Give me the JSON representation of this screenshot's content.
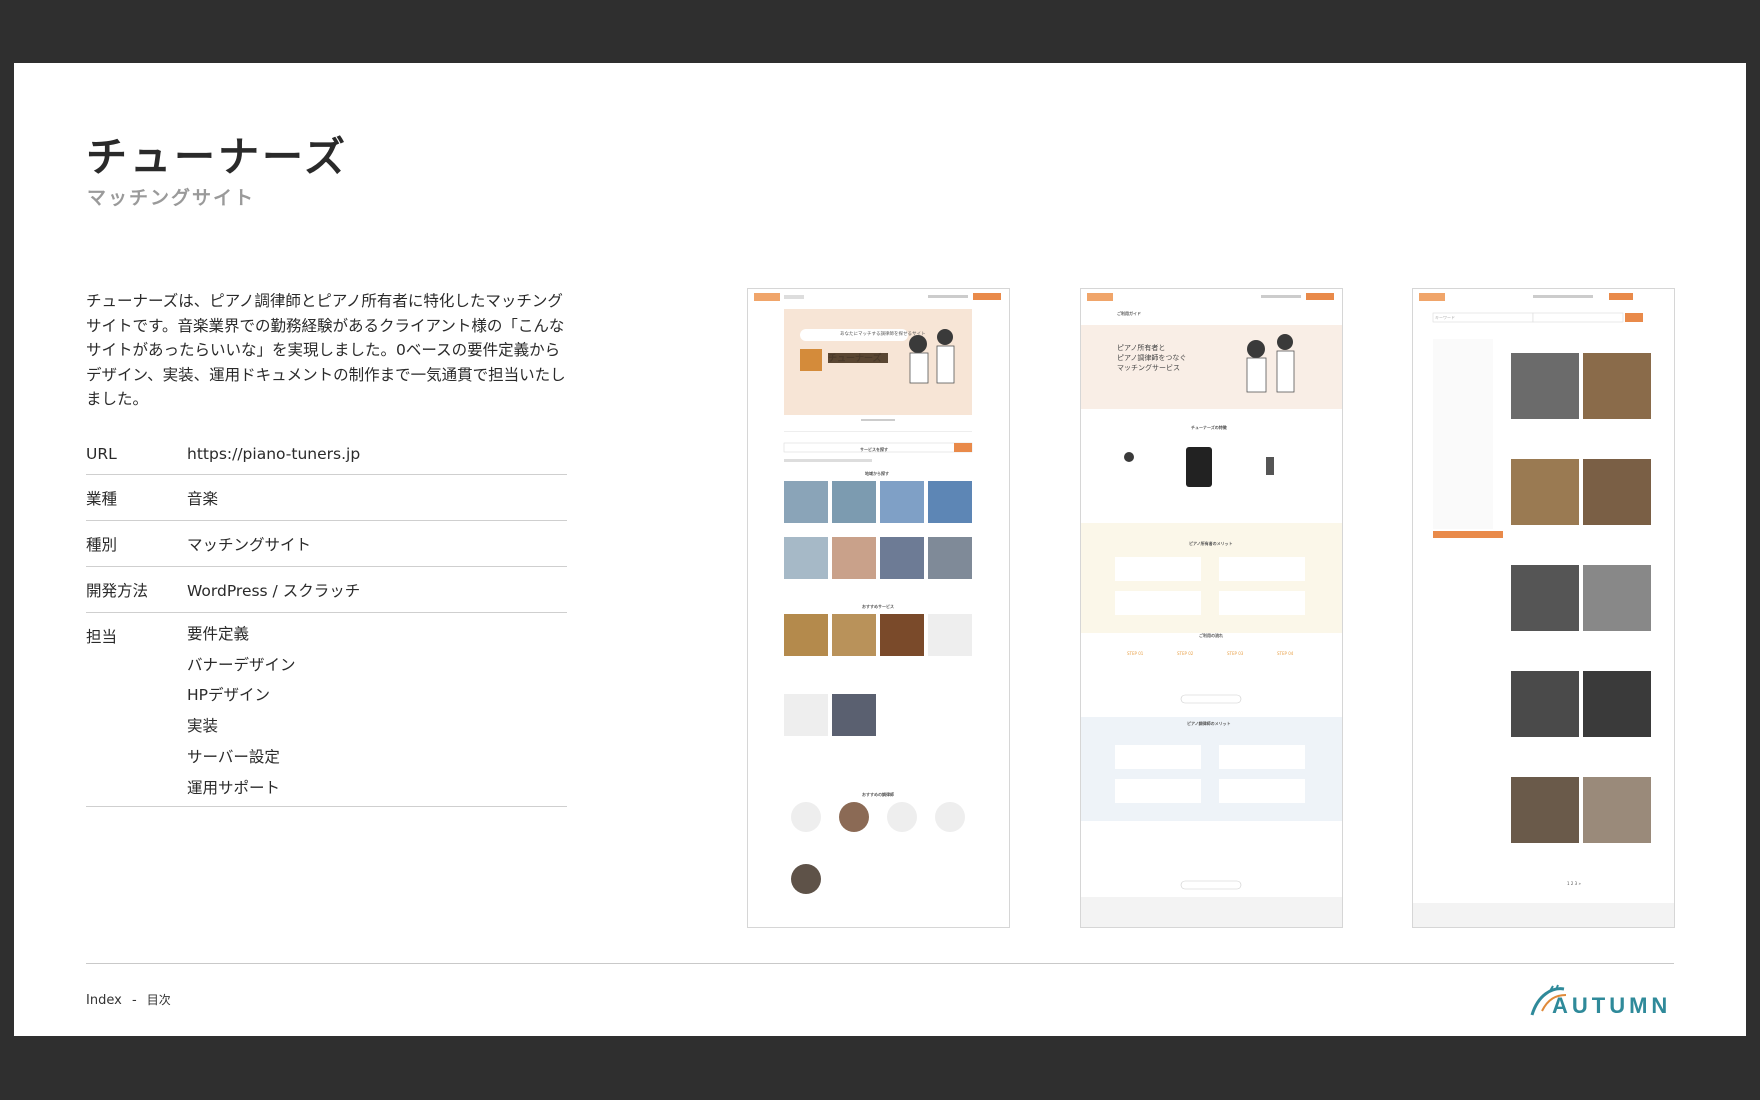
{
  "slide": {
    "title": "チューナーズ",
    "subtitle": "マッチングサイト",
    "description": "チューナーズは、ピアノ調律師とピアノ所有者に特化したマッチングサイトです。音楽業界での勤務経験があるクライアント様の「こんなサイトがあったらいいな」を実現しました。0ベースの要件定義からデザイン、実装、運用ドキュメントの制作まで一気通貫で担当いたしました。"
  },
  "info": {
    "url_label": "URL",
    "url_value": "https://piano-tuners.jp",
    "industry_label": "業種",
    "industry_value": "音楽",
    "type_label": "種別",
    "type_value": "マッチングサイト",
    "method_label": "開発方法",
    "method_value": "WordPress / スクラッチ",
    "role_label": "担当",
    "roles": [
      "要件定義",
      "バナーデザイン",
      "HPデザイン",
      "実装",
      "サーバー設定",
      "運用サポート"
    ]
  },
  "footer": {
    "index": "Index",
    "sep": "-",
    "toc": "目次",
    "logo_text": "AUTUMN"
  },
  "mock1": {
    "hero_tagline": "あなたにマッチする調律師を探せるサイト",
    "hero_brand": "チューナーズ",
    "hero_brand_en": "tuners",
    "section_search": "サービスを探す",
    "section_region": "地域から探す",
    "section_services": "おすすめサービス",
    "section_tuners": "おすすめの調律師"
  },
  "mock2": {
    "guide": "ご利用ガイド",
    "hero_line1": "ピアノ所有者と",
    "hero_line2": "ピアノ調律師をつなぐ",
    "hero_line3": "マッチングサービス",
    "features": "チューナーズの特徴",
    "merit_owner": "ピアノ所有者のメリット",
    "flow": "ご利用の流れ",
    "merit_tuner": "ピアノ調律師のメリット",
    "steps": [
      "STEP 01",
      "STEP 02",
      "STEP 03",
      "STEP 04"
    ]
  },
  "mock3": {
    "search_placeholder": "キーワード",
    "pager": "1 2 3 »"
  }
}
